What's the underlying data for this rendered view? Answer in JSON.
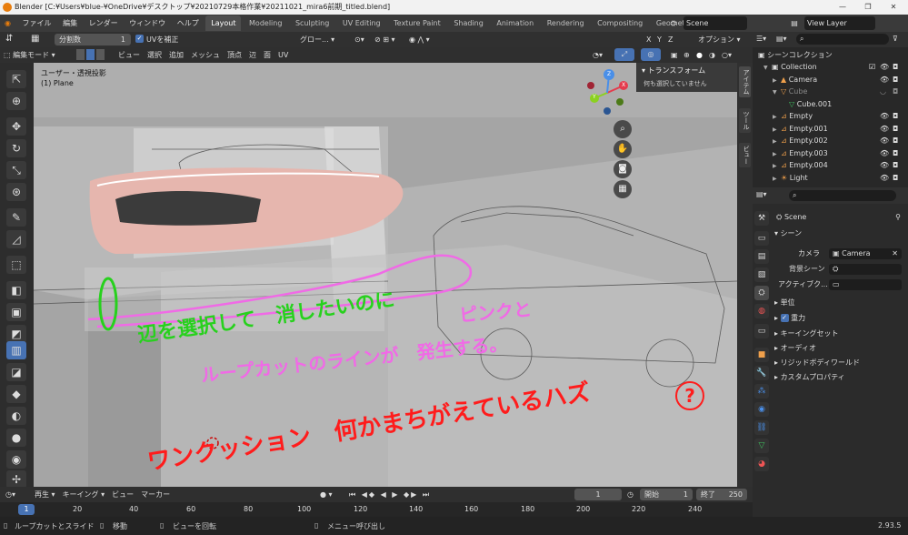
{
  "titlebar": {
    "title": "Blender [C:¥Users¥blue-¥OneDrive¥デスクトップ¥20210729本格作業¥20211021_mira6前期_titled.blend]",
    "min": "—",
    "max": "❐",
    "close": "✕"
  },
  "menu": {
    "items": [
      "ファイル",
      "編集",
      "レンダー",
      "ウィンドウ",
      "ヘルプ"
    ],
    "workspaces": [
      "Layout",
      "Modeling",
      "Sculpting",
      "UV Editing",
      "Texture Paint",
      "Shading",
      "Animation",
      "Rendering",
      "Compositing",
      "Geometry Node"
    ],
    "scene_label": "Scene",
    "view_layer_label": "View Layer"
  },
  "tool_header": {
    "cuts_label": "分割数",
    "cuts_value": "1",
    "uv_correct": "UVを補正",
    "transform_orientation": "グロー...",
    "axes": [
      "X",
      "Y",
      "Z"
    ],
    "options": "オプション"
  },
  "viewport_header": {
    "mode": "編集モード",
    "menus": [
      "ビュー",
      "選択",
      "追加",
      "メッシュ",
      "頂点",
      "辺",
      "面",
      "UV"
    ]
  },
  "viewport": {
    "view_name": "ユーザー・透視投影",
    "object_name": "(1) Plane",
    "gizmo": {
      "x": "X",
      "y": "Y",
      "z": "Z"
    },
    "bg_color": "#aeaeae"
  },
  "npanel": {
    "title": "トランスフォーム",
    "message": "何も選択していません",
    "tabs": [
      "アイテム",
      "ツール",
      "ビュー"
    ]
  },
  "annotations": {
    "line1": "辺を選択して　消したいのに",
    "line1b": "ピンクと",
    "line2": "ループカットのラインが　発生する。",
    "line3": "ワンクッション　何かまちがえているハズ",
    "question": "?",
    "green_color": "#27d11d",
    "pink_color": "#f06ae6",
    "red_color": "#ff1c1c"
  },
  "timeline": {
    "menus": [
      "再生",
      "キーイング",
      "ビュー",
      "マーカー"
    ],
    "current_frame": "1",
    "start_label": "開始",
    "start_value": "1",
    "end_label": "終了",
    "end_value": "250",
    "ruler": [
      "1",
      "20",
      "40",
      "60",
      "80",
      "100",
      "120",
      "140",
      "160",
      "180",
      "200",
      "220",
      "240"
    ]
  },
  "statusbar": {
    "item1": "ループカットとスライド",
    "item2": "移動",
    "item3": "ビューを回転",
    "item4": "メニュー呼び出し",
    "version": "2.93.5"
  },
  "outliner": {
    "title": "シーンコレクション",
    "rows": [
      {
        "name": "Collection",
        "depth": 0
      },
      {
        "name": "Camera",
        "depth": 1
      },
      {
        "name": "Cube",
        "depth": 1
      },
      {
        "name": "Cube.001",
        "depth": 2
      },
      {
        "name": "Empty",
        "depth": 1
      },
      {
        "name": "Empty.001",
        "depth": 1
      },
      {
        "name": "Empty.002",
        "depth": 1
      },
      {
        "name": "Empty.003",
        "depth": 1
      },
      {
        "name": "Empty.004",
        "depth": 1
      },
      {
        "name": "Light",
        "depth": 1
      }
    ]
  },
  "properties": {
    "scene_name": "Scene",
    "section_scene": "シーン",
    "camera_label": "カメラ",
    "camera_value": "Camera",
    "bg_scene_label": "背景シーン",
    "active_clip_label": "アクティブク...",
    "panels": [
      "単位",
      "重力",
      "キーイングセット",
      "オーディオ",
      "リジッドボディワールド",
      "カスタムプロパティ"
    ]
  }
}
